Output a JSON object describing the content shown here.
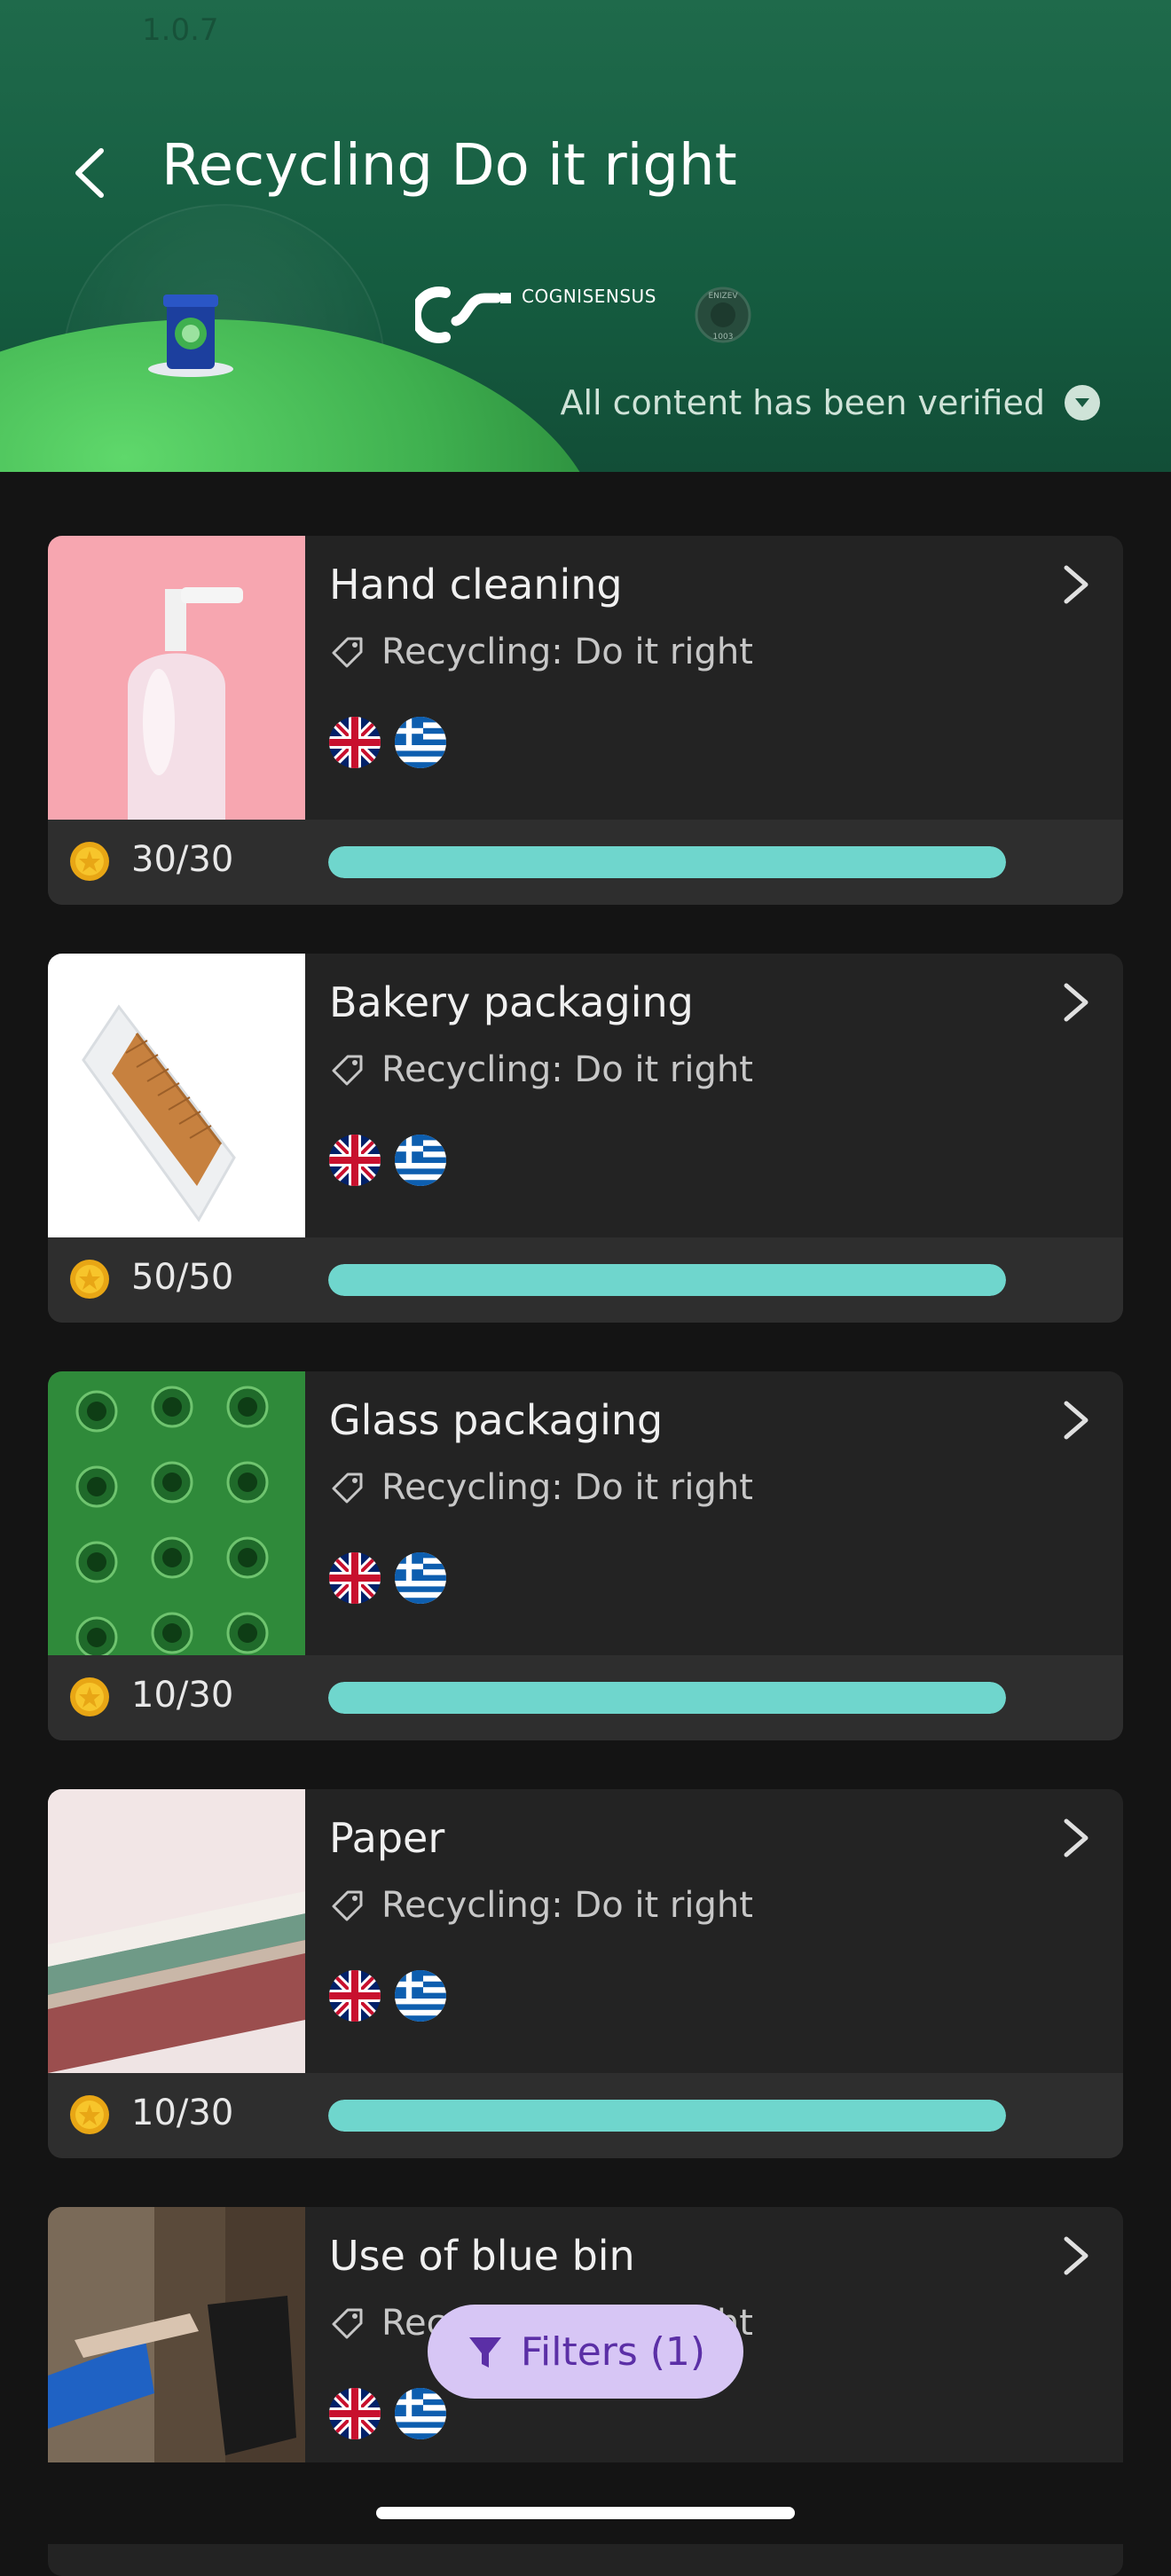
{
  "app": {
    "version": "1.0.7"
  },
  "header": {
    "title": "Recycling Do it right",
    "partner_name": "COGNISENSUS",
    "badge_text_top": "ENIZEV",
    "badge_text_bottom": "1003",
    "verified_text": "All content has been verified"
  },
  "colors": {
    "progress": "#6fd6cd",
    "header_green": "#1f6a4b",
    "filter_bg": "#d7c6f5",
    "filter_text": "#5b2fa6"
  },
  "cards": [
    {
      "title": "Hand cleaning",
      "tag": "Recycling: Do it right",
      "languages": [
        "English",
        "Greek"
      ],
      "points": "30/30",
      "progress": 1.0,
      "image": "soap-bottle"
    },
    {
      "title": "Bakery packaging",
      "tag": "Recycling: Do it right",
      "languages": [
        "English",
        "Greek"
      ],
      "points": "50/50",
      "progress": 1.0,
      "image": "sliced-bread-bag"
    },
    {
      "title": "Glass packaging",
      "tag": "Recycling: Do it right",
      "languages": [
        "English",
        "Greek"
      ],
      "points": "10/30",
      "progress": 1.0,
      "image": "green-glass-bottles"
    },
    {
      "title": "Paper",
      "tag": "Recycling: Do it right",
      "languages": [
        "English",
        "Greek"
      ],
      "points": "10/30",
      "progress": 1.0,
      "image": "notebooks-stack"
    },
    {
      "title": "Use of blue bin",
      "tag": "Recycling: Do it right",
      "languages": [
        "English",
        "Greek"
      ],
      "points": "",
      "progress": 0,
      "image": "blue-bin-disposal"
    }
  ],
  "filters": {
    "label": "Filters (1)"
  },
  "icons": {
    "back": "chevron-left-icon",
    "chevron": "chevron-right-icon",
    "tag": "tag-icon",
    "coin": "coin-icon",
    "filter": "filter-icon",
    "dropdown": "caret-down-icon"
  }
}
